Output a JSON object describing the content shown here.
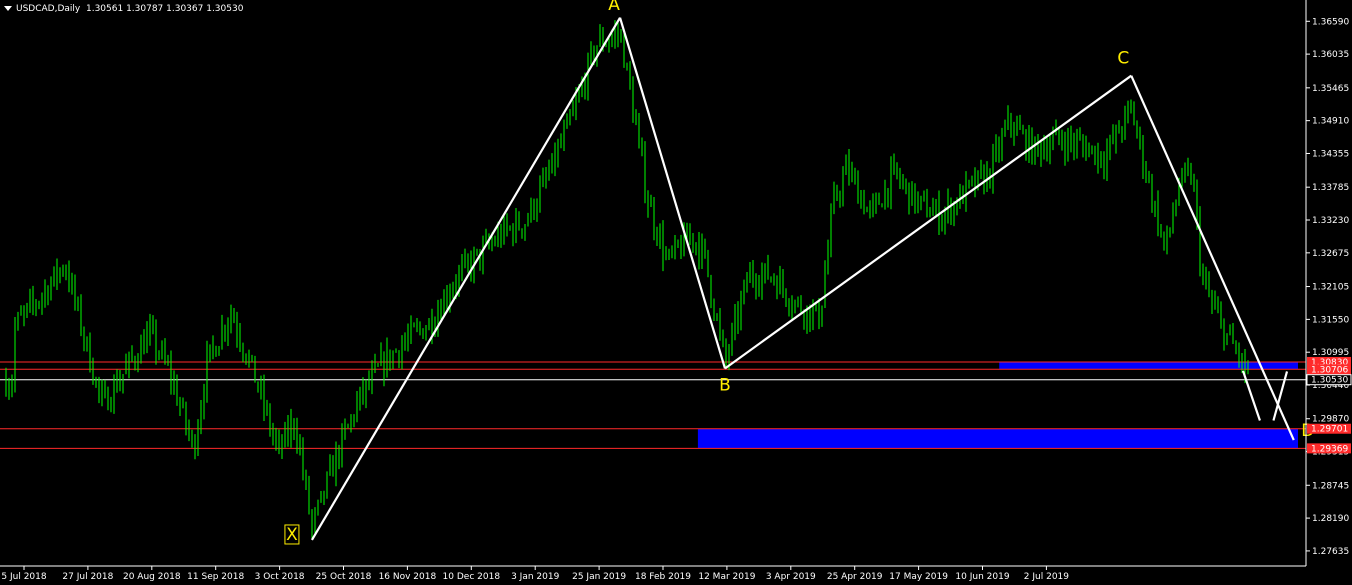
{
  "header": {
    "symbol": "USDCAD,Daily",
    "ohlc": "1.30561 1.30787 1.30367 1.30530"
  },
  "colors": {
    "background": "#000000",
    "candle": "#00ff00",
    "pattern_line": "#ffffff",
    "label": "#ffee00",
    "zone": "#0000ff",
    "level_line": "#ff2a2a",
    "price_line": "#ffffff",
    "axis": "#ffffff"
  },
  "chart_data": {
    "type": "line",
    "title": "",
    "xlabel": "",
    "ylabel": "",
    "ylim": [
      1.2738,
      1.3695
    ],
    "x_tick_labels": [
      "5 Jul 2018",
      "27 Jul 2018",
      "20 Aug 2018",
      "11 Sep 2018",
      "3 Oct 2018",
      "25 Oct 2018",
      "16 Nov 2018",
      "10 Dec 2018",
      "3 Jan 2019",
      "25 Jan 2019",
      "18 Feb 2019",
      "12 Mar 2019",
      "3 Apr 2019",
      "25 Apr 2019",
      "17 May 2019",
      "10 Jun 2019",
      "2 Jul 2019"
    ],
    "y_tick_labels": [
      "1.36590",
      "1.36035",
      "1.35465",
      "1.34910",
      "1.34355",
      "1.33785",
      "1.33230",
      "1.32675",
      "1.32105",
      "1.31550",
      "1.30995",
      "1.30440",
      "1.29870",
      "1.29315",
      "1.28745",
      "1.28190",
      "1.27635"
    ],
    "y_ticks": [
      1.3659,
      1.36035,
      1.35465,
      1.3491,
      1.34355,
      1.33785,
      1.3323,
      1.32675,
      1.32105,
      1.3155,
      1.30995,
      1.3044,
      1.2987,
      1.29315,
      1.28745,
      1.2819,
      1.27635
    ],
    "price_labels": [
      {
        "text": "1.30830",
        "value": 1.3083,
        "color": "#ff2a2a"
      },
      {
        "text": "1.30706",
        "value": 1.30706,
        "color": "#ff2a2a"
      },
      {
        "text": "1.30530",
        "value": 1.3053,
        "color": "#ffffff"
      },
      {
        "text": "1.29701",
        "value": 1.29701,
        "color": "#ff2a2a"
      },
      {
        "text": "1.29369",
        "value": 1.29369,
        "color": "#ff2a2a"
      }
    ],
    "horizontal_lines": [
      1.3083,
      1.30706,
      1.29701,
      1.29369
    ],
    "current_price": 1.3053,
    "zones": [
      {
        "from_date": "2019-04-22",
        "to_date": "2019-07-26",
        "top": 1.3083,
        "bottom": 1.30706
      },
      {
        "from_date": "2019-01-23",
        "to_date": "2019-07-26",
        "top": 1.29701,
        "bottom": 1.29369
      }
    ],
    "pattern": [
      {
        "label": "X",
        "date": "2018-10-01",
        "price": 1.2782
      },
      {
        "label": "A",
        "date": "2018-12-31",
        "price": 1.3665
      },
      {
        "label": "B",
        "date": "2019-01-31",
        "price": 1.3072
      },
      {
        "label": "C",
        "date": "2019-05-31",
        "price": 1.3567
      },
      {
        "label": "D",
        "date": "2019-07-18",
        "price": 1.2951
      }
    ],
    "projection_legs": [
      [
        {
          "date": "2019-07-03",
          "price": 1.3068
        },
        {
          "date": "2019-07-08",
          "price": 1.2984
        }
      ],
      [
        {
          "date": "2019-07-12",
          "price": 1.2984
        },
        {
          "date": "2019-07-16",
          "price": 1.3067
        }
      ]
    ],
    "candle_anchors": [
      {
        "date": "2018-07-05",
        "price": 1.314
      },
      {
        "date": "2018-07-13",
        "price": 1.3195
      },
      {
        "date": "2018-07-20",
        "price": 1.325
      },
      {
        "date": "2018-07-31",
        "price": 1.301
      },
      {
        "date": "2018-08-07",
        "price": 1.307
      },
      {
        "date": "2018-08-14",
        "price": 1.313
      },
      {
        "date": "2018-08-20",
        "price": 1.3065
      },
      {
        "date": "2018-08-27",
        "price": 1.2935
      },
      {
        "date": "2018-08-31",
        "price": 1.308
      },
      {
        "date": "2018-09-07",
        "price": 1.317
      },
      {
        "date": "2018-09-14",
        "price": 1.306
      },
      {
        "date": "2018-09-21",
        "price": 1.293
      },
      {
        "date": "2018-09-26",
        "price": 1.2985
      },
      {
        "date": "2018-10-01",
        "price": 1.28
      },
      {
        "date": "2018-10-08",
        "price": 1.292
      },
      {
        "date": "2018-10-15",
        "price": 1.302
      },
      {
        "date": "2018-10-22",
        "price": 1.308
      },
      {
        "date": "2018-10-29",
        "price": 1.312
      },
      {
        "date": "2018-11-05",
        "price": 1.315
      },
      {
        "date": "2018-11-12",
        "price": 1.322
      },
      {
        "date": "2018-11-19",
        "price": 1.326
      },
      {
        "date": "2018-11-26",
        "price": 1.33
      },
      {
        "date": "2018-12-03",
        "price": 1.332
      },
      {
        "date": "2018-12-10",
        "price": 1.34
      },
      {
        "date": "2018-12-17",
        "price": 1.35
      },
      {
        "date": "2018-12-24",
        "price": 1.362
      },
      {
        "date": "2018-12-31",
        "price": 1.364
      },
      {
        "date": "2019-01-03",
        "price": 1.354
      },
      {
        "date": "2019-01-08",
        "price": 1.336
      },
      {
        "date": "2019-01-14",
        "price": 1.325
      },
      {
        "date": "2019-01-21",
        "price": 1.33
      },
      {
        "date": "2019-01-25",
        "price": 1.326
      },
      {
        "date": "2019-01-31",
        "price": 1.308
      },
      {
        "date": "2019-02-07",
        "price": 1.323
      },
      {
        "date": "2019-02-14",
        "price": 1.323
      },
      {
        "date": "2019-02-21",
        "price": 1.318
      },
      {
        "date": "2019-02-28",
        "price": 1.316
      },
      {
        "date": "2019-03-04",
        "price": 1.335
      },
      {
        "date": "2019-03-08",
        "price": 1.341
      },
      {
        "date": "2019-03-15",
        "price": 1.333
      },
      {
        "date": "2019-03-22",
        "price": 1.34
      },
      {
        "date": "2019-03-29",
        "price": 1.335
      },
      {
        "date": "2019-04-05",
        "price": 1.333
      },
      {
        "date": "2019-04-12",
        "price": 1.337
      },
      {
        "date": "2019-04-19",
        "price": 1.34
      },
      {
        "date": "2019-04-25",
        "price": 1.349
      },
      {
        "date": "2019-05-02",
        "price": 1.344
      },
      {
        "date": "2019-05-09",
        "price": 1.346
      },
      {
        "date": "2019-05-16",
        "price": 1.345
      },
      {
        "date": "2019-05-23",
        "price": 1.343
      },
      {
        "date": "2019-05-31",
        "price": 1.351
      },
      {
        "date": "2019-06-05",
        "price": 1.339
      },
      {
        "date": "2019-06-10",
        "price": 1.327
      },
      {
        "date": "2019-06-14",
        "price": 1.338
      },
      {
        "date": "2019-06-18",
        "price": 1.34
      },
      {
        "date": "2019-06-21",
        "price": 1.322
      },
      {
        "date": "2019-06-26",
        "price": 1.315
      },
      {
        "date": "2019-07-01",
        "price": 1.31
      },
      {
        "date": "2019-07-05",
        "price": 1.3053
      }
    ]
  }
}
